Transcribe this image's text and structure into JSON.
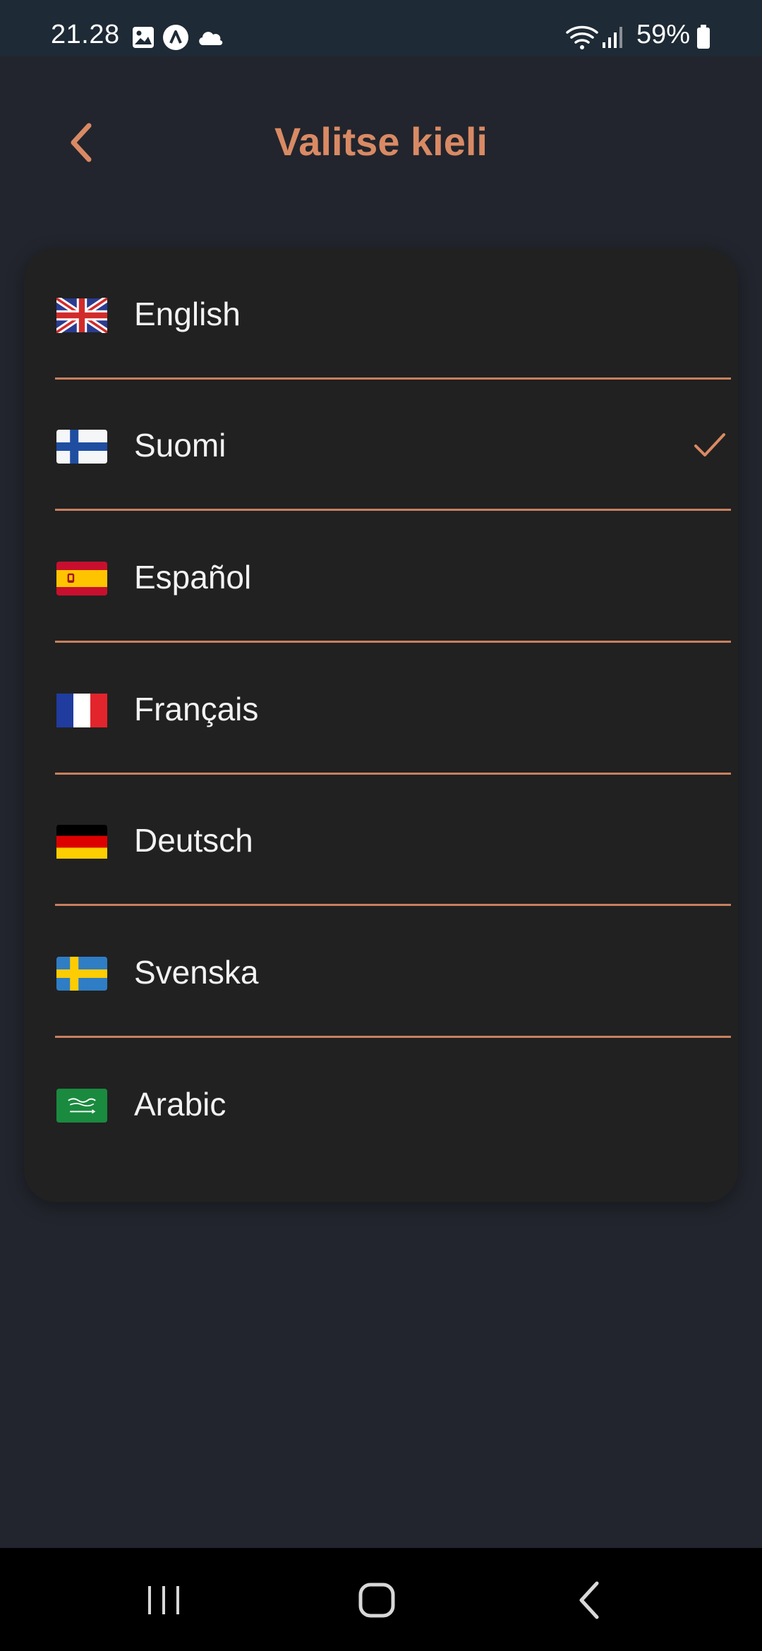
{
  "status_bar": {
    "time": "21.28",
    "battery": "59%",
    "icons": [
      "gallery-icon",
      "app-a-icon",
      "cloud-icon",
      "wifi-icon",
      "signal-icon",
      "battery-icon"
    ]
  },
  "header": {
    "title": "Valitse kieli",
    "back_icon": "chevron-left-icon"
  },
  "languages": [
    {
      "label": "English",
      "flag": "uk-flag-icon",
      "selected": false
    },
    {
      "label": "Suomi",
      "flag": "finland-flag-icon",
      "selected": true
    },
    {
      "label": "Español",
      "flag": "spain-flag-icon",
      "selected": false
    },
    {
      "label": "Français",
      "flag": "france-flag-icon",
      "selected": false
    },
    {
      "label": "Deutsch",
      "flag": "germany-flag-icon",
      "selected": false
    },
    {
      "label": "Svenska",
      "flag": "sweden-flag-icon",
      "selected": false
    },
    {
      "label": "Arabic",
      "flag": "saudi-flag-icon",
      "selected": false
    }
  ],
  "nav_bar": {
    "icons": [
      "recent-apps-icon",
      "home-icon",
      "back-icon"
    ]
  },
  "colors": {
    "accent": "#d98a64",
    "background": "#22252d",
    "card": "#212121",
    "separator": "#c9805f",
    "text": "#f2f2f2"
  }
}
